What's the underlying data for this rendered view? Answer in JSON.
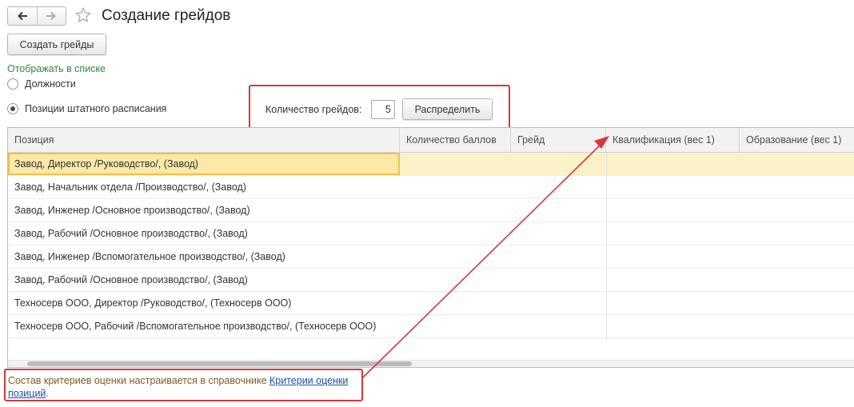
{
  "window": {
    "title": "Создание грейдов",
    "back_icon": "arrow-left-icon",
    "forward_icon": "arrow-right-icon",
    "favorite_icon": "star-outline-icon"
  },
  "toolbar": {
    "create_grades_label": "Создать грейды"
  },
  "display_options": {
    "label": "Отображать в списке",
    "options": [
      {
        "label": "Должности",
        "selected": false
      },
      {
        "label": "Позиции штатного расписания",
        "selected": true
      }
    ]
  },
  "grades": {
    "count_label": "Количество грейдов:",
    "count_value": "5",
    "distribute_label": "Распределить"
  },
  "table": {
    "columns": [
      "Позиция",
      "Количество баллов",
      "Грейд",
      "Квалификация (вес 1)",
      "Образование (вес 1)"
    ],
    "rows": [
      {
        "position": "Завод, Директор /Руководство/, (Завод)",
        "points": "",
        "grade": "",
        "qualification": "",
        "education": ""
      },
      {
        "position": "Завод, Начальник отдела /Производство/, (Завод)",
        "points": "",
        "grade": "",
        "qualification": "",
        "education": ""
      },
      {
        "position": "Завод, Инженер /Основное производство/, (Завод)",
        "points": "",
        "grade": "",
        "qualification": "",
        "education": ""
      },
      {
        "position": "Завод, Рабочий /Основное производство/, (Завод)",
        "points": "",
        "grade": "",
        "qualification": "",
        "education": ""
      },
      {
        "position": "Завод, Инженер /Вспомогательное производство/, (Завод)",
        "points": "",
        "grade": "",
        "qualification": "",
        "education": ""
      },
      {
        "position": "Завод, Рабочий /Основное производство/, (Завод)",
        "points": "",
        "grade": "",
        "qualification": "",
        "education": ""
      },
      {
        "position": "Техносерв ООО, Директор /Руководство/, (Техносерв ООО)",
        "points": "",
        "grade": "",
        "qualification": "",
        "education": ""
      },
      {
        "position": "Техносерв ООО, Рабочий /Вспомогательное производство/, (Техносерв ООО)",
        "points": "",
        "grade": "",
        "qualification": "",
        "education": ""
      }
    ]
  },
  "footer": {
    "note_text": "Состав критериев оценки настраивается в справочнике ",
    "link_text": "Критерии оценки позиций",
    "note_end": "."
  },
  "colors": {
    "accent_green": "#2e8b3a",
    "callout_red": "#d23a3a",
    "selection_yellow": "#fbf2c8",
    "link_blue": "#1d4fb5"
  }
}
